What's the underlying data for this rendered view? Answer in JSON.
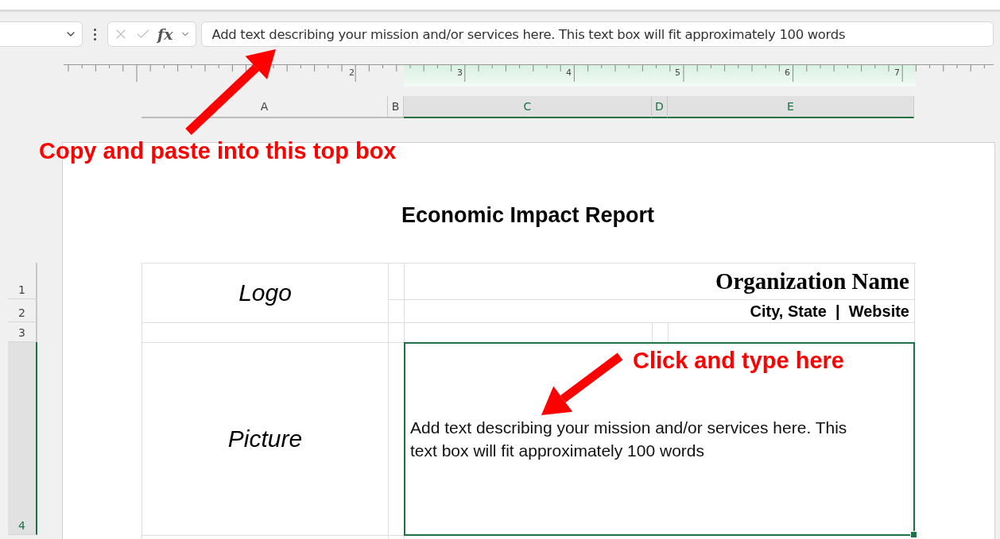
{
  "formula_bar": {
    "function_label": "fx",
    "value": "Add text describing your mission and/or services here. This text box will fit approximately 100 words"
  },
  "ruler": {
    "labels": [
      "2",
      "3",
      "4",
      "5",
      "6",
      "7"
    ]
  },
  "columns": [
    {
      "label": "A",
      "selected": false
    },
    {
      "label": "B",
      "selected": false
    },
    {
      "label": "C",
      "selected": true
    },
    {
      "label": "D",
      "selected": true
    },
    {
      "label": "E",
      "selected": true
    }
  ],
  "rows": [
    {
      "label": "1",
      "selected": false
    },
    {
      "label": "2",
      "selected": false
    },
    {
      "label": "3",
      "selected": false
    },
    {
      "label": "4",
      "selected": true
    }
  ],
  "annotations": [
    {
      "text": "Copy and paste into this top box"
    },
    {
      "text": "Click and type here"
    }
  ],
  "report": {
    "title": "Economic Impact Report",
    "logo": "Logo",
    "organization": "Organization Name",
    "location": "City, State  |  Website",
    "picture": "Picture",
    "description": {
      "text": "Add text describing your mission and/or services here. This text box will fit approximately 100 words",
      "selected": true
    }
  }
}
